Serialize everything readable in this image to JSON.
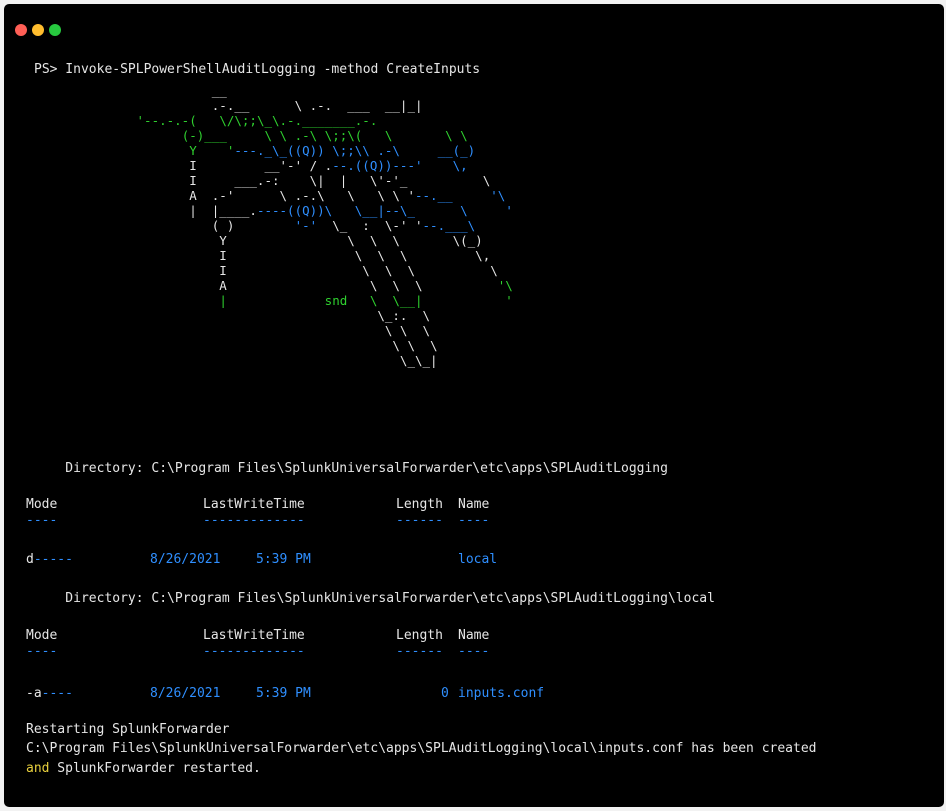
{
  "colors": {
    "background": "#000000",
    "text": "#e6e6e6",
    "accent_blue": "#2f8fff",
    "ascii_green": "#2fd12f",
    "keyword_yellow": "#e7cf3d",
    "traffic_red": "#ff5f56",
    "traffic_yellow": "#ffbd2e",
    "traffic_green": "#27c93f"
  },
  "window_controls": [
    "close",
    "minimize",
    "zoom"
  ],
  "command": "PS> Invoke-SPLPowerShellAuditLogging -method CreateInputs",
  "ascii_art_caption": "snd",
  "listings": [
    {
      "directory": "    Directory: C:\\Program Files\\SplunkUniversalForwarder\\etc\\apps\\SPLAuditLogging",
      "headers": {
        "mode": "Mode",
        "last_write_time": "LastWriteTime",
        "length": "Length",
        "name": "Name"
      },
      "rules": {
        "mode": "----",
        "last_write_time": "-------------",
        "length": "------",
        "name": "----"
      },
      "rows": [
        {
          "mode_prefix": "d",
          "mode_rest": "-----",
          "date": "8/26/2021",
          "time": "5:39 PM",
          "length": "",
          "name": "local"
        }
      ]
    },
    {
      "directory": "    Directory: C:\\Program Files\\SplunkUniversalForwarder\\etc\\apps\\SPLAuditLogging\\local",
      "headers": {
        "mode": "Mode",
        "last_write_time": "LastWriteTime",
        "length": "Length",
        "name": "Name"
      },
      "rules": {
        "mode": "----",
        "last_write_time": "-------------",
        "length": "------",
        "name": "----"
      },
      "rows": [
        {
          "mode_prefix": "-a",
          "mode_rest": "----",
          "date": "8/26/2021",
          "time": "5:39 PM",
          "length": "0",
          "name": "inputs.conf"
        }
      ]
    }
  ],
  "messages": {
    "restarting": "Restarting SplunkForwarder",
    "created": "C:\\Program Files\\SplunkUniversalForwarder\\etc\\apps\\SPLAuditLogging\\local\\inputs.conf has been created",
    "and_word": "and",
    "restarted": " SplunkForwarder restarted."
  }
}
